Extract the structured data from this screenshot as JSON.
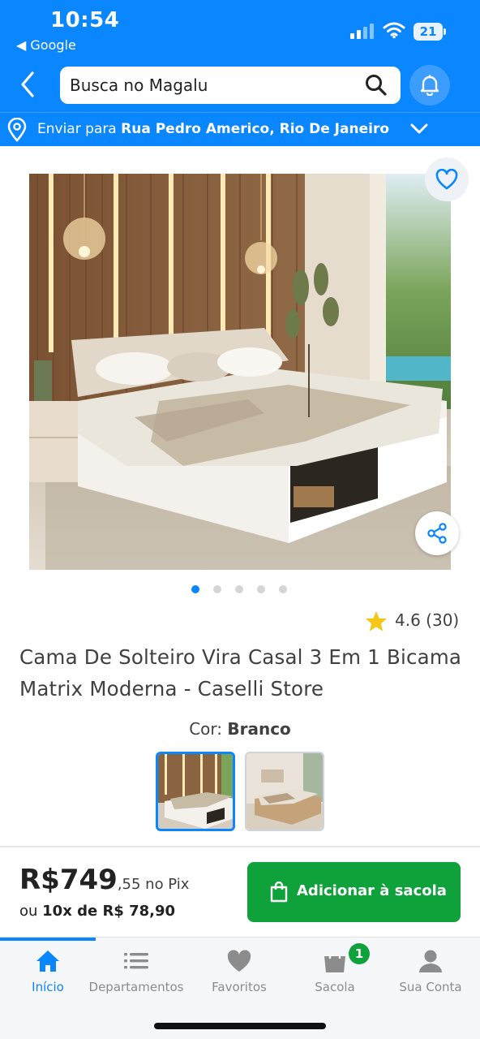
{
  "status": {
    "time": "10:54",
    "back_app": "◀ Google",
    "battery": "21"
  },
  "header": {
    "search_text": "Busca no Magalu"
  },
  "address": {
    "prefix": "Enviar para ",
    "location": "Rua Pedro Americo, Rio De Janeiro"
  },
  "carousel": {
    "count": 5,
    "active_index": 0
  },
  "product": {
    "rating": "4.6 (30)",
    "title": "Cama De Solteiro Vira Casal 3 Em 1 Bicama Matrix Moderna - Caselli Store",
    "color_prefix": "Cor: ",
    "color_value": "Branco"
  },
  "purchase": {
    "price_main": "R$749",
    "price_cents": ",55 no Pix",
    "installments_prefix": "ou ",
    "installments_value": "10x de R$ 78,90",
    "add_button": "Adicionar à sacola"
  },
  "tabs": [
    {
      "label": "Início",
      "icon": "home-icon",
      "active": true
    },
    {
      "label": "Departamentos",
      "icon": "list-icon"
    },
    {
      "label": "Favoritos",
      "icon": "heart-icon"
    },
    {
      "label": "Sacola",
      "icon": "bag-icon",
      "badge": "1"
    },
    {
      "label": "Sua Conta",
      "icon": "user-icon"
    }
  ],
  "colors": {
    "brand_blue": "#0a86ff",
    "green": "#0fa23a",
    "text": "#404040"
  }
}
